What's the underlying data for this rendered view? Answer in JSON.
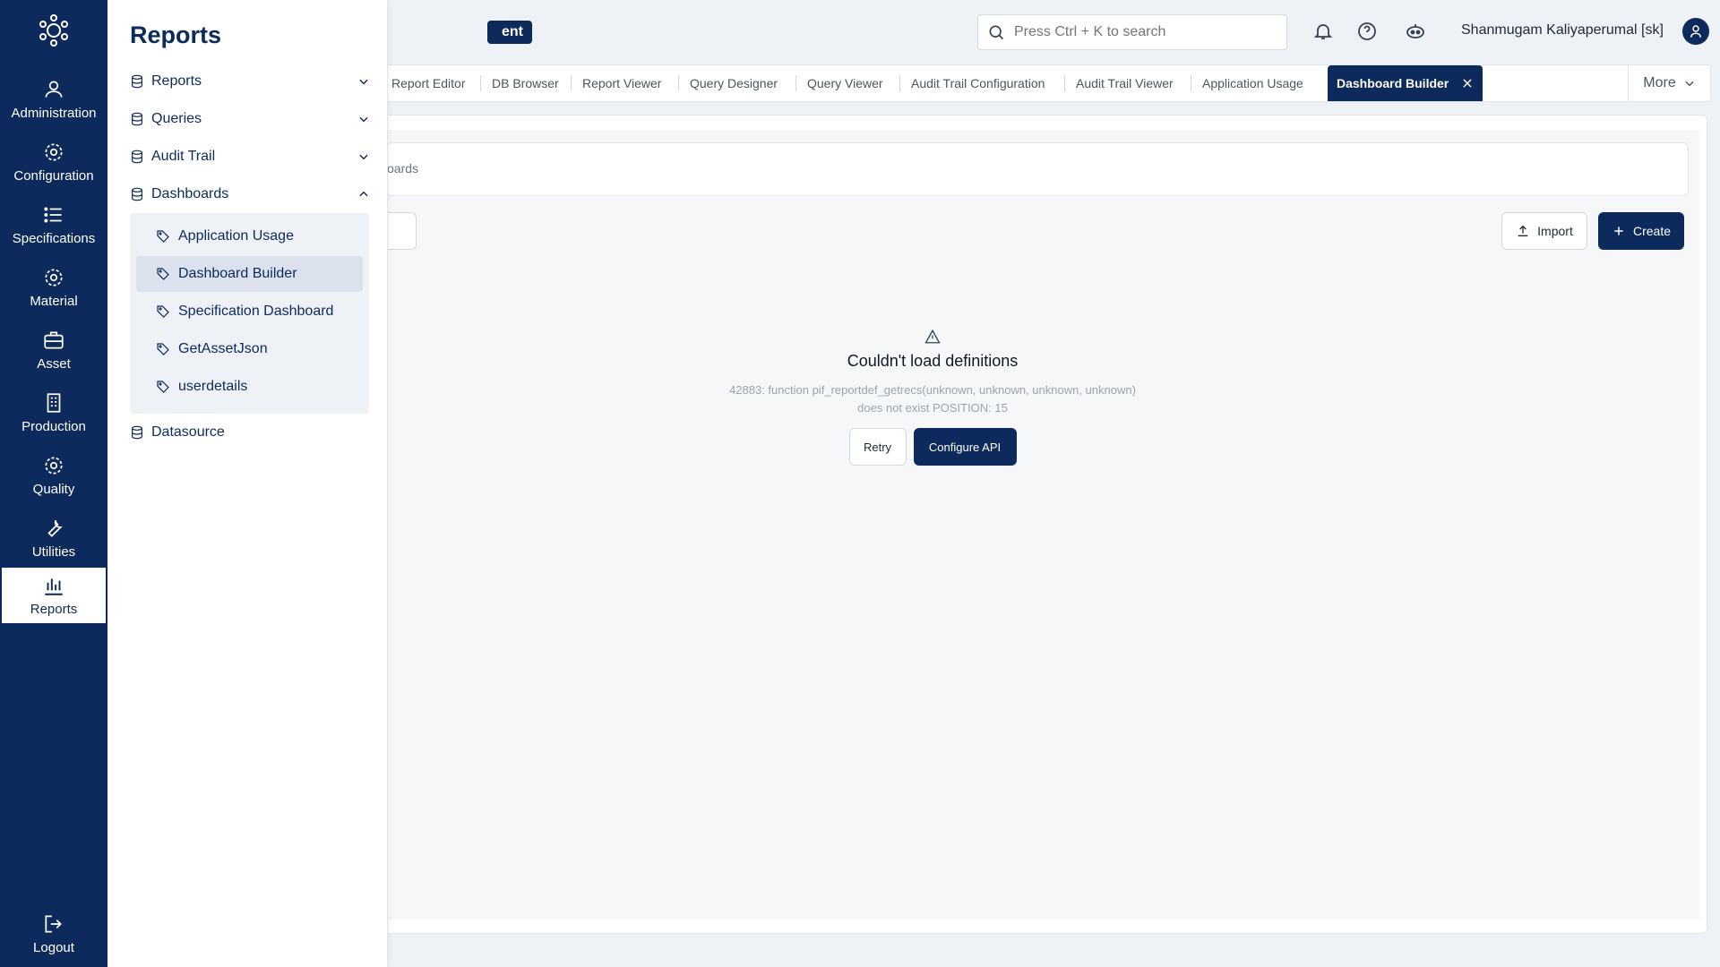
{
  "rail": {
    "items": [
      {
        "label": "Administration",
        "icon": "users-icon"
      },
      {
        "label": "Configuration",
        "icon": "gear-icon"
      },
      {
        "label": "Specifications",
        "icon": "list-icon"
      },
      {
        "label": "Material",
        "icon": "gear-icon"
      },
      {
        "label": "Asset",
        "icon": "briefcase-icon"
      },
      {
        "label": "Production",
        "icon": "building-icon"
      },
      {
        "label": "Quality",
        "icon": "gear-icon"
      },
      {
        "label": "Utilities",
        "icon": "wrench-icon"
      },
      {
        "label": "Reports",
        "icon": "bar-chart-icon"
      }
    ],
    "logout_label": "Logout"
  },
  "header": {
    "badge_text": "ent",
    "search_placeholder": "Press Ctrl + K to search",
    "user_name": "Shanmugam Kaliyaperumal [sk]"
  },
  "tabs": {
    "items": [
      "Report Editor",
      "DB Browser",
      "Report Viewer",
      "Query Designer",
      "Query Viewer",
      "Audit Trail Configuration",
      "Audit Trail Viewer",
      "Application Usage"
    ],
    "active": "Dashboard Builder",
    "more_label": "More"
  },
  "main": {
    "breadcrumb": "oards",
    "import_label": "Import",
    "create_label": "Create",
    "error_title": "Couldn't load definitions",
    "error_message": "42883: function pif_reportdef_getrecs(unknown, unknown, unknown, unknown) does not exist POSITION: 15",
    "retry_label": "Retry",
    "configure_label": "Configure API"
  },
  "flyout": {
    "title": "Reports",
    "sections": [
      {
        "label": "Reports",
        "state": "collapsed"
      },
      {
        "label": "Queries",
        "state": "collapsed"
      },
      {
        "label": "Audit Trail",
        "state": "collapsed"
      },
      {
        "label": "Dashboards",
        "state": "expanded"
      }
    ],
    "dashboard_items": [
      "Application Usage",
      "Dashboard Builder",
      "Specification Dashboard",
      "GetAssetJson",
      "userdetails"
    ],
    "active_item": "Dashboard Builder",
    "datasource_label": "Datasource"
  },
  "colors": {
    "brand": "#0d2a5c",
    "background": "#eef1f6"
  }
}
